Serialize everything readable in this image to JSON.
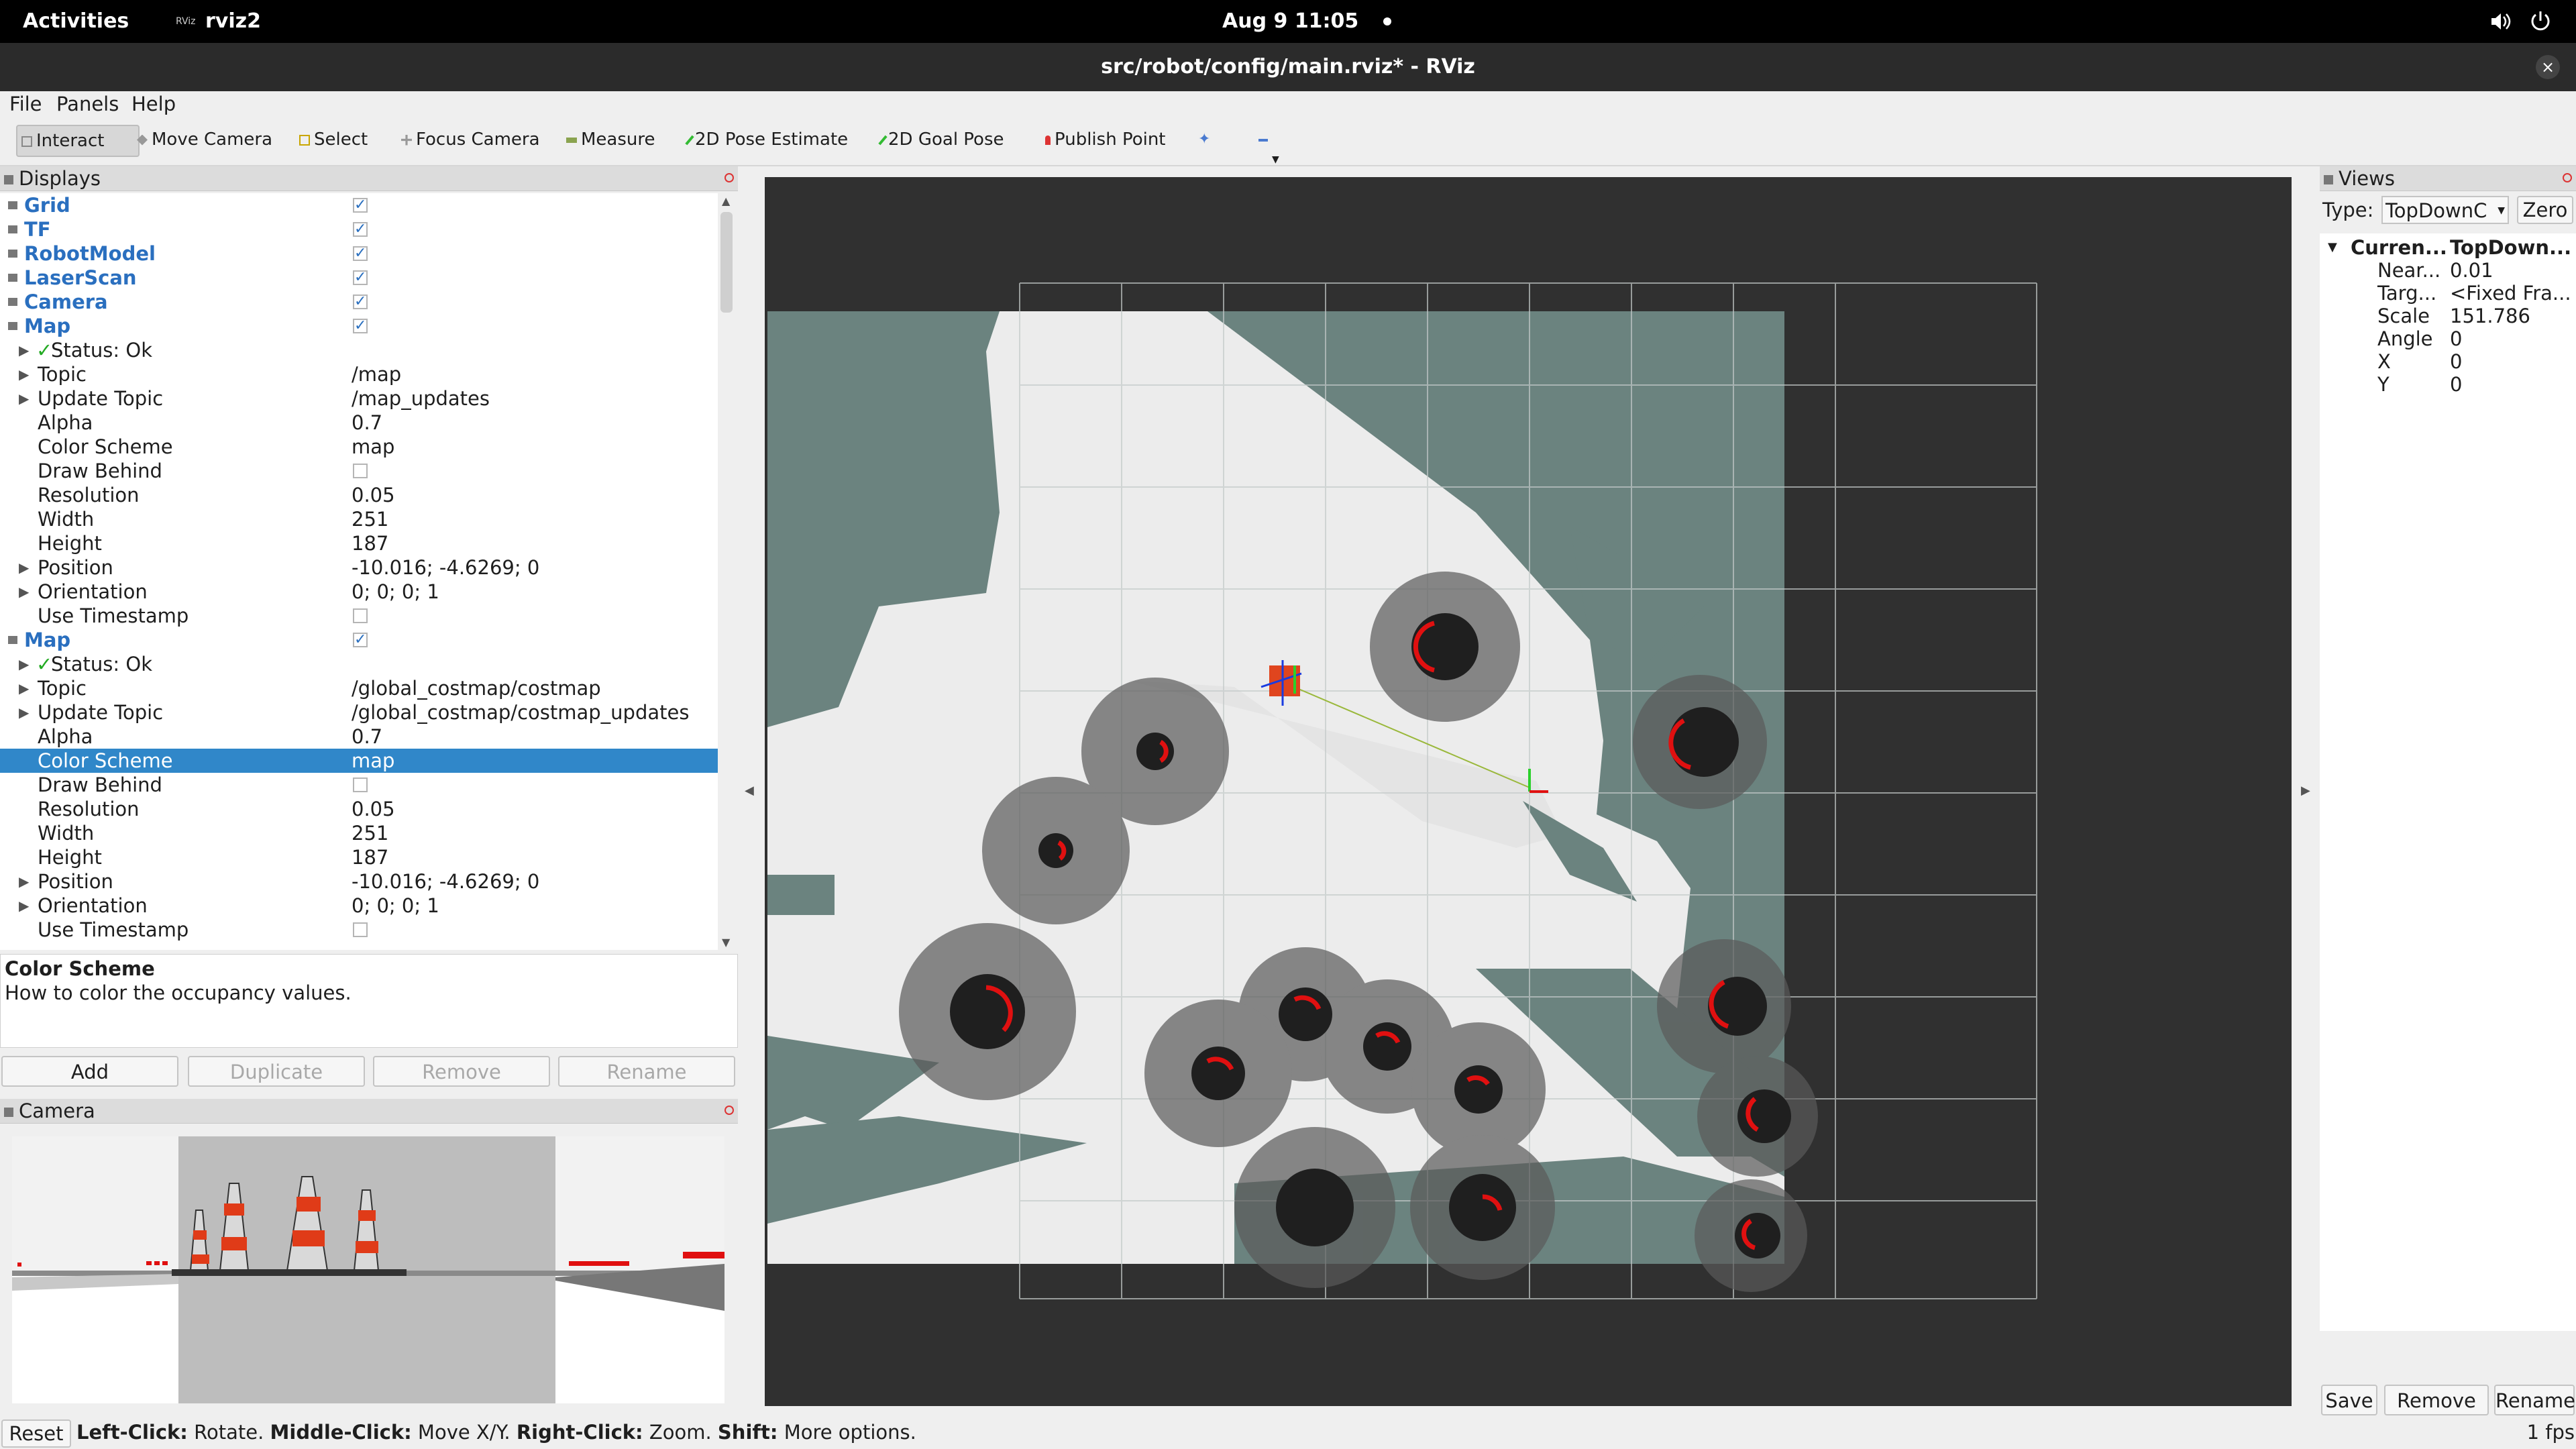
{
  "topbar": {
    "activities": "Activities",
    "app": "rviz2",
    "app_icon": "RViz",
    "clock": "Aug 9  11:05"
  },
  "window": {
    "title": "src/robot/config/main.rviz* - RViz",
    "close": "×"
  },
  "menu": [
    "File",
    "Panels",
    "Help"
  ],
  "toolbar": [
    "Interact",
    "Move Camera",
    "Select",
    "Focus Camera",
    "Measure",
    "2D Pose Estimate",
    "2D Goal Pose",
    "Publish Point"
  ],
  "displays": {
    "title": "Displays",
    "top": [
      {
        "name": "Grid",
        "checked": true
      },
      {
        "name": "TF",
        "checked": true
      },
      {
        "name": "RobotModel",
        "checked": true
      },
      {
        "name": "LaserScan",
        "checked": true
      },
      {
        "name": "Camera",
        "checked": true
      }
    ],
    "map1": {
      "name": "Map",
      "props": [
        {
          "name": "Status: Ok",
          "value": "",
          "expand": true,
          "ok": true
        },
        {
          "name": "Topic",
          "value": "/map",
          "expand": true
        },
        {
          "name": "Update Topic",
          "value": "/map_updates",
          "expand": true
        },
        {
          "name": "Alpha",
          "value": "0.7"
        },
        {
          "name": "Color Scheme",
          "value": "map"
        },
        {
          "name": "Draw Behind",
          "value": "",
          "checkbox": true
        },
        {
          "name": "Resolution",
          "value": "0.05"
        },
        {
          "name": "Width",
          "value": "251"
        },
        {
          "name": "Height",
          "value": "187"
        },
        {
          "name": "Position",
          "value": "-10.016; -4.6269; 0",
          "expand": true
        },
        {
          "name": "Orientation",
          "value": "0; 0; 0; 1",
          "expand": true
        },
        {
          "name": "Use Timestamp",
          "value": "",
          "checkbox": true
        }
      ]
    },
    "map2": {
      "name": "Map",
      "props": [
        {
          "name": "Status: Ok",
          "value": "",
          "expand": true,
          "ok": true
        },
        {
          "name": "Topic",
          "value": "/global_costmap/costmap",
          "expand": true
        },
        {
          "name": "Update Topic",
          "value": "/global_costmap/costmap_updates",
          "expand": true
        },
        {
          "name": "Alpha",
          "value": "0.7"
        },
        {
          "name": "Color Scheme",
          "value": "map",
          "selected": true
        },
        {
          "name": "Draw Behind",
          "value": "",
          "checkbox": true
        },
        {
          "name": "Resolution",
          "value": "0.05"
        },
        {
          "name": "Width",
          "value": "251"
        },
        {
          "name": "Height",
          "value": "187"
        },
        {
          "name": "Position",
          "value": "-10.016; -4.6269; 0",
          "expand": true
        },
        {
          "name": "Orientation",
          "value": "0; 0; 0; 1",
          "expand": true
        },
        {
          "name": "Use Timestamp",
          "value": "",
          "checkbox": true
        }
      ]
    },
    "desc_title": "Color Scheme",
    "desc_text": "How to color the occupancy values.",
    "buttons": {
      "add": "Add",
      "duplicate": "Duplicate",
      "remove": "Remove",
      "rename": "Rename"
    }
  },
  "camera_panel": {
    "title": "Camera"
  },
  "views": {
    "title": "Views",
    "type_label": "Type:",
    "type_value": "TopDownC",
    "zero": "Zero",
    "current_name": "Curren...",
    "current_value": "TopDown...",
    "props": [
      {
        "name": "Near...",
        "value": "0.01"
      },
      {
        "name": "Targ...",
        "value": "<Fixed Fra..."
      },
      {
        "name": "Scale",
        "value": "151.786"
      },
      {
        "name": "Angle",
        "value": "0"
      },
      {
        "name": "X",
        "value": "0"
      },
      {
        "name": "Y",
        "value": "0"
      }
    ],
    "buttons": {
      "save": "Save",
      "remove": "Remove",
      "rename": "Rename"
    }
  },
  "status": {
    "reset": "Reset",
    "left_click": "Left-Click:",
    "rotate": " Rotate. ",
    "middle_click": "Middle-Click:",
    "move": " Move X/Y. ",
    "right_click": "Right-Click:",
    "zoom": " Zoom. ",
    "shift": "Shift:",
    "more": " More options.",
    "fps": "1 fps"
  }
}
